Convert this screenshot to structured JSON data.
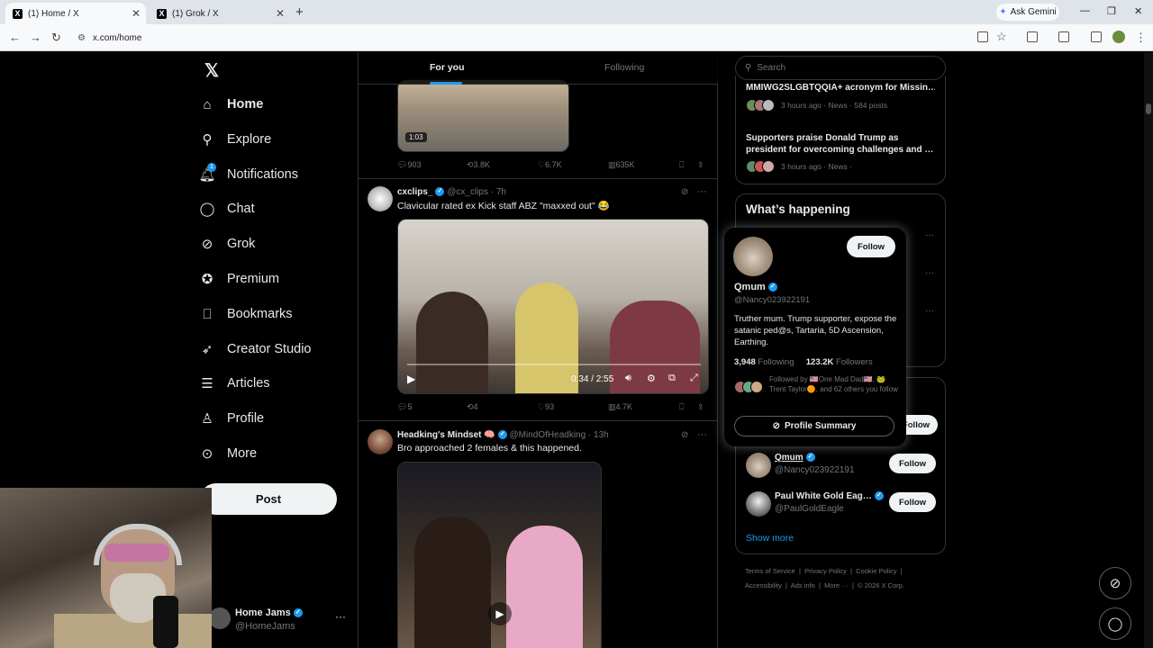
{
  "browser": {
    "tabs": [
      {
        "title": "(1) Home / X",
        "active": true
      },
      {
        "title": "(1) Grok / X",
        "active": false
      }
    ],
    "ask_gemini": "Ask Gemini",
    "url": "x.com/home"
  },
  "nav": {
    "items": [
      {
        "label": "Home",
        "icon": "home-icon"
      },
      {
        "label": "Explore",
        "icon": "search-icon"
      },
      {
        "label": "Notifications",
        "icon": "bell-icon",
        "badge": "1"
      },
      {
        "label": "Chat",
        "icon": "chat-icon"
      },
      {
        "label": "Grok",
        "icon": "grok-icon"
      },
      {
        "label": "Premium",
        "icon": "premium-icon"
      },
      {
        "label": "Bookmarks",
        "icon": "bookmark-icon"
      },
      {
        "label": "Creator Studio",
        "icon": "rocket-icon"
      },
      {
        "label": "Articles",
        "icon": "article-icon"
      },
      {
        "label": "Profile",
        "icon": "person-icon"
      },
      {
        "label": "More",
        "icon": "more-circle-icon"
      }
    ],
    "post_label": "Post",
    "account": {
      "name": "Home Jams",
      "handle": "@HomeJams"
    }
  },
  "feed": {
    "tabs": [
      "For you",
      "Following"
    ],
    "top_video_time": "1:03",
    "top_actions": {
      "replies": "903",
      "reposts": "3.8K",
      "likes": "6.7K",
      "views": "635K"
    },
    "tweets": [
      {
        "name": "cxclips_",
        "handle": "@cx_clips",
        "time": "· 7h",
        "text": "Clavicular rated ex Kick staff ABZ \"maxxed out\" 😂",
        "video_time": "0:34 / 2:55",
        "actions": {
          "replies": "5",
          "reposts": "4",
          "likes": "93",
          "views": "4.7K"
        }
      },
      {
        "name": "Headking's Mindset 🧠",
        "handle": "@MindOfHeadking",
        "time": "· 13h",
        "text": "Bro approached 2 females & this happened."
      }
    ]
  },
  "right": {
    "search_placeholder": "Search",
    "trends": [
      {
        "title": "MMIWG2SLGBTQQIA+ acronym for Missin…",
        "meta": "3 hours ago · News · 584 posts"
      },
      {
        "title": "Supporters praise Donald Trump as president for overcoming challenges and …",
        "meta": "3 hours ago · News ·"
      }
    ],
    "whats_happening": "What’s happening",
    "who_to_follow": [
      {
        "name": "Qmum",
        "handle": "@Nancy023922191"
      },
      {
        "name": "Paul White Gold Eag…",
        "handle": "@PaulGoldEagle"
      }
    ],
    "follow_label": "Follow",
    "show_more": "Show more",
    "footer_line1": [
      "Terms of Service",
      "Privacy Policy",
      "Cookie Policy"
    ],
    "footer_line2": [
      "Accessibility",
      "Ads info",
      "More ···",
      "© 2026 X Corp."
    ]
  },
  "hovercard": {
    "name": "Qmum",
    "handle": "@Nancy023922191",
    "bio": "Truther mum. Trump supporter, expose the satanic ped@s, Tartaria, 5D Ascension, Earthing.",
    "following": "3,948",
    "following_label": "Following",
    "followers": "123.2K",
    "followers_label": "Followers",
    "followed_by": "Followed by 🇺🇸One Mad Dad🇺🇸, 🐸Trent Taylor🟠, and 62 others you follow",
    "follow_label": "Follow",
    "summary_label": "Profile Summary"
  },
  "colors": {
    "accent": "#1d9bf0",
    "background": "#000000",
    "border": "#2f3336",
    "muted": "#71767b"
  }
}
